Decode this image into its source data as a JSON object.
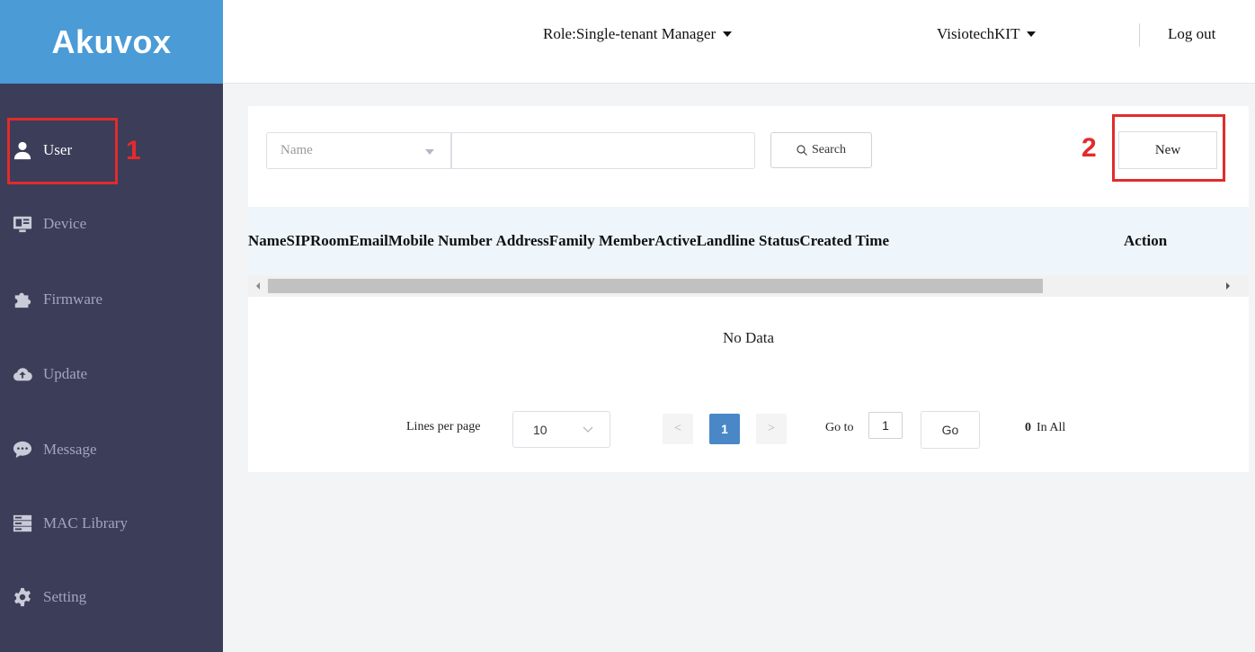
{
  "brand": {
    "logo_text": "Akuvox",
    "logo_bg": "#4a9bd6",
    "sidebar_bg": "#3b3d59"
  },
  "header": {
    "role_label": "Role:Single-tenant Manager",
    "account_label": "VisiotechKIT",
    "logout_label": "Log out"
  },
  "sidebar": {
    "items": [
      {
        "label": "User",
        "icon": "user-icon",
        "active": true
      },
      {
        "label": "Device",
        "icon": "device-icon"
      },
      {
        "label": "Firmware",
        "icon": "puzzle-icon"
      },
      {
        "label": "Update",
        "icon": "cloud-upload-icon"
      },
      {
        "label": "Message",
        "icon": "message-icon"
      },
      {
        "label": "MAC Library",
        "icon": "server-icon"
      },
      {
        "label": "Setting",
        "icon": "gear-icon"
      }
    ]
  },
  "search": {
    "field_select": "Name",
    "input_value": "",
    "button_label": "Search"
  },
  "toolbar": {
    "new_label": "New"
  },
  "annotations": {
    "marker_1": "1",
    "marker_2": "2",
    "color": "#e22b2b"
  },
  "table": {
    "columns": [
      "Name",
      "SIP",
      "Room",
      "Email",
      "Mobile Number",
      "Address",
      "Family Member",
      "Active",
      "Landline Status",
      "Created Time"
    ],
    "action_column": "Action",
    "empty_text": "No Data"
  },
  "pagination": {
    "lines_label": "Lines per page",
    "lines_value": "10",
    "prev": "<",
    "current_page": "1",
    "next": ">",
    "goto_label": "Go to",
    "goto_value": "1",
    "go_button": "Go",
    "total_count": "0",
    "total_label": "In All",
    "accent": "#4a87c7"
  }
}
